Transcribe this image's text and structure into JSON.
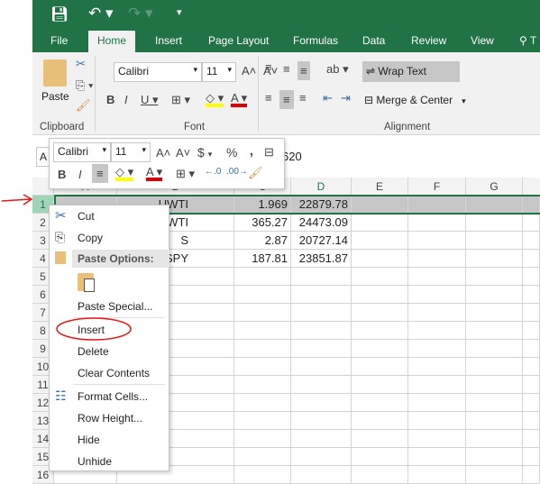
{
  "quick_access": {
    "save": "save-icon",
    "undo": "undo-icon",
    "redo": "redo-icon",
    "customize": "customize-icon"
  },
  "tabs": [
    "File",
    "Home",
    "Insert",
    "Page Layout",
    "Formulas",
    "Data",
    "Review",
    "View",
    "T"
  ],
  "ribbon": {
    "clipboard": {
      "label": "Clipboard",
      "paste": "Paste"
    },
    "font": {
      "label": "Font",
      "name": "Calibri",
      "size": "11"
    },
    "alignment": {
      "label": "Alignment",
      "wrap_text": "Wrap Text",
      "merge_center": "Merge & Center"
    }
  },
  "formula_bar": {
    "name_box": "A",
    "value": "620"
  },
  "columns": [
    "A",
    "B",
    "C",
    "D",
    "E",
    "F",
    "G"
  ],
  "rows": [
    "1",
    "2",
    "3",
    "4",
    "5",
    "6",
    "7",
    "8",
    "9",
    "10",
    "11",
    "12",
    "13",
    "14",
    "15",
    "16"
  ],
  "cells": [
    {
      "b": "UWTI",
      "c": "1.969",
      "d": "22879.78"
    },
    {
      "b": "WTI",
      "c": "365.27",
      "d": "24473.09"
    },
    {
      "b": "S",
      "c": "2.87",
      "d": "20727.14"
    },
    {
      "b": "SPY",
      "c": "187.81",
      "d": "23851.87"
    }
  ],
  "mini_toolbar": {
    "font": "Calibri",
    "size": "11",
    "currency": "$",
    "percent": "%",
    "comma": ",",
    "bold": "B",
    "italic": "I"
  },
  "context_menu": {
    "cut": "Cut",
    "copy": "Copy",
    "paste_options": "Paste Options:",
    "paste_special": "Paste Special...",
    "insert": "Insert",
    "delete": "Delete",
    "clear_contents": "Clear Contents",
    "format_cells": "Format Cells...",
    "row_height": "Row Height...",
    "hide": "Hide",
    "unhide": "Unhide"
  },
  "colors": {
    "brand": "#217346",
    "annotation": "#e8161b",
    "selection_row": "#c6c6c6"
  }
}
